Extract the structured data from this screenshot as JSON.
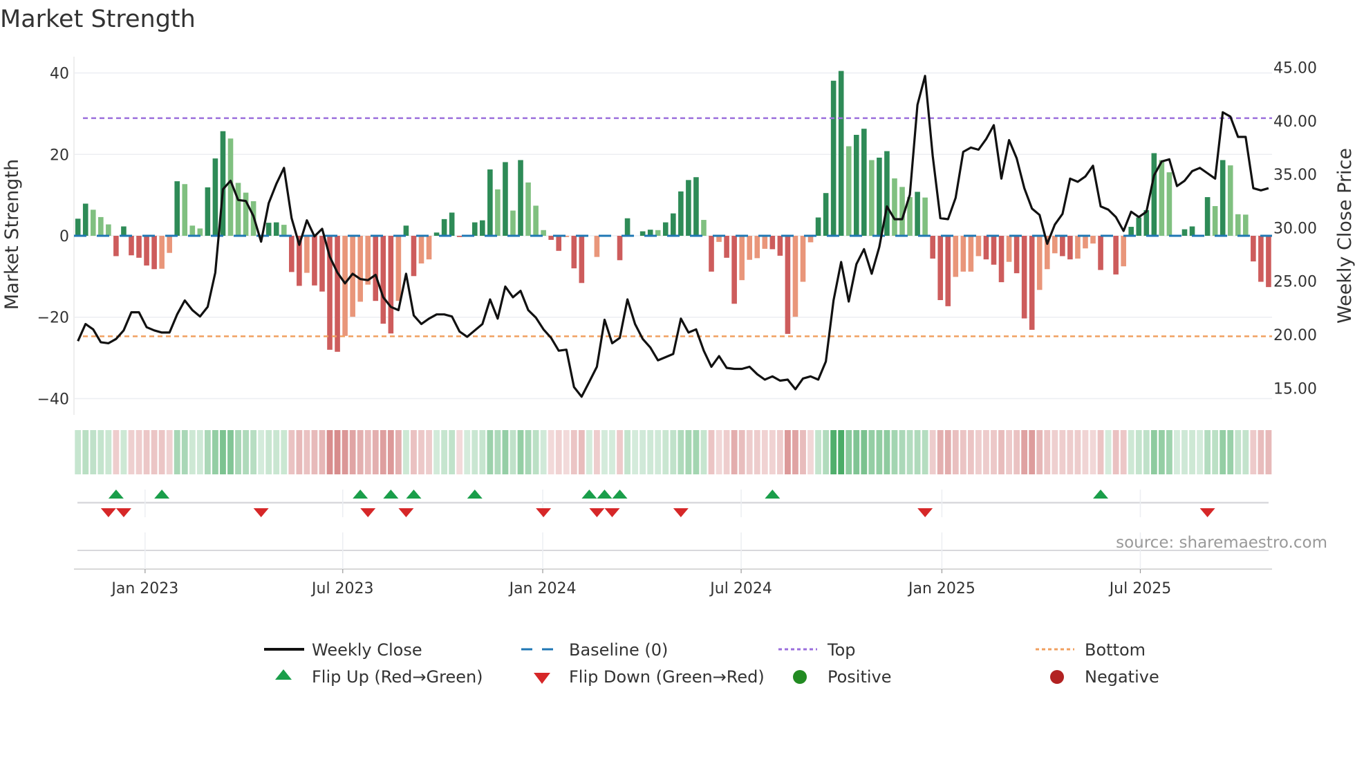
{
  "chart_data": {
    "type": "bar+line",
    "title": "Market Strength",
    "ylabel_left": "Market Strength",
    "ylabel_right": "Weekly Close Price",
    "ylim_left": [
      -44,
      44
    ],
    "ylim_right": [
      12.5,
      46.0
    ],
    "yticks_left": [
      {
        "value": 40,
        "label": "40"
      },
      {
        "value": 20,
        "label": "20"
      },
      {
        "value": 0,
        "label": "0"
      },
      {
        "value": -20,
        "label": "−20"
      },
      {
        "value": -40,
        "label": "−40"
      }
    ],
    "yticks_right": [
      {
        "value": 45,
        "label": "45.00"
      },
      {
        "value": 40,
        "label": "40.00"
      },
      {
        "value": 35,
        "label": "35.00"
      },
      {
        "value": 30,
        "label": "30.00"
      },
      {
        "value": 25,
        "label": "25.00"
      },
      {
        "value": 20,
        "label": "20.00"
      },
      {
        "value": 15,
        "label": "15.00"
      }
    ],
    "x_unit": "week index (weekly bars, first bar ~ early Nov 2022)",
    "xticks": [
      {
        "week": 9.8,
        "label": "Jan 2023"
      },
      {
        "week": 35.7,
        "label": "Jul 2023"
      },
      {
        "week": 61.9,
        "label": "Jan 2024"
      },
      {
        "week": 87.9,
        "label": "Jul 2024"
      },
      {
        "week": 114.2,
        "label": "Jan 2025"
      },
      {
        "week": 140.2,
        "label": "Jul 2025"
      }
    ],
    "strength": [
      4.2,
      7.9,
      6.4,
      4.6,
      2.8,
      -5.0,
      2.3,
      -4.8,
      -5.4,
      -7.3,
      -8.2,
      -8.1,
      -4.2,
      13.4,
      12.7,
      2.5,
      1.8,
      11.9,
      19.0,
      25.7,
      23.9,
      13.0,
      10.6,
      8.5,
      0,
      3.2,
      3.3,
      2.7,
      -8.9,
      -12.3,
      -9.1,
      -12.2,
      -13.7,
      -28.0,
      -28.5,
      -24.6,
      -19.9,
      -16.2,
      -12.0,
      -16.0,
      -21.6,
      -24.0,
      -16.0,
      2.5,
      -9.9,
      -6.8,
      -5.8,
      0.8,
      4.1,
      5.7,
      -0.3,
      0,
      3.3,
      3.8,
      16.3,
      11.4,
      18.1,
      6.2,
      18.6,
      13.1,
      7.4,
      1.4,
      -1.0,
      -3.7,
      -0.3,
      -8.0,
      -11.6,
      0,
      -5.2,
      0,
      0,
      -6.0,
      4.3,
      0,
      1.1,
      1.5,
      1.4,
      3.3,
      5.5,
      10.9,
      13.7,
      14.4,
      3.9,
      -8.8,
      -1.5,
      -5.4,
      -16.7,
      -10.9,
      -5.9,
      -5.5,
      -3.2,
      -3.3,
      -4.9,
      -24.1,
      -19.9,
      -11.3,
      -1.6,
      4.5,
      10.5,
      38.1,
      40.5,
      22.0,
      24.8,
      26.3,
      18.6,
      19.2,
      20.8,
      14.1,
      12.0,
      9.5,
      10.8,
      9.4,
      -5.6,
      -15.8,
      -17.3,
      -10.1,
      -8.8,
      -8.8,
      -5.0,
      -5.8,
      -7.1,
      -11.4,
      -6.4,
      -9.2,
      -20.3,
      -23.1,
      -13.3,
      -8.2,
      -4.3,
      -5.0,
      -5.8,
      -5.6,
      -3.1,
      -1.9,
      -8.4,
      0,
      -9.5,
      -7.5,
      2.2,
      4.5,
      6.3,
      20.3,
      18.6,
      15.6,
      0,
      1.6,
      2.3,
      0,
      9.5,
      7.3,
      18.6,
      17.3,
      5.3,
      5.2,
      -6.3,
      -11.3,
      -12.6
    ],
    "strengthening": [
      1,
      1,
      0,
      0,
      0,
      1,
      1,
      1,
      1,
      1,
      1,
      0,
      0,
      1,
      0,
      0,
      0,
      1,
      1,
      1,
      0,
      0,
      0,
      0,
      0,
      1,
      1,
      0,
      1,
      1,
      0,
      1,
      1,
      1,
      1,
      0,
      0,
      0,
      0,
      1,
      1,
      1,
      0,
      1,
      1,
      0,
      0,
      1,
      1,
      1,
      1,
      0,
      1,
      1,
      1,
      0,
      1,
      0,
      1,
      0,
      0,
      0,
      1,
      1,
      0,
      1,
      1,
      0,
      0,
      0,
      0,
      1,
      1,
      0,
      1,
      1,
      0,
      1,
      1,
      1,
      1,
      1,
      0,
      1,
      0,
      1,
      1,
      0,
      0,
      0,
      0,
      1,
      1,
      1,
      0,
      0,
      0,
      1,
      1,
      1,
      1,
      0,
      1,
      1,
      0,
      1,
      1,
      0,
      0,
      0,
      1,
      0,
      1,
      1,
      1,
      0,
      0,
      0,
      0,
      1,
      1,
      1,
      0,
      1,
      1,
      1,
      0,
      0,
      0,
      1,
      1,
      0,
      0,
      0,
      1,
      0,
      1,
      0,
      1,
      1,
      1,
      1,
      0,
      0,
      0,
      1,
      1,
      0,
      1,
      0,
      1,
      0,
      0,
      0,
      1,
      1,
      1
    ],
    "weekly_close": [
      19.4,
      21.0,
      20.5,
      19.3,
      19.2,
      19.6,
      20.4,
      22.1,
      22.1,
      20.7,
      20.4,
      20.2,
      20.2,
      21.9,
      23.2,
      22.3,
      21.7,
      22.6,
      25.8,
      33.6,
      34.4,
      32.6,
      32.5,
      31.1,
      28.7,
      32.3,
      34.1,
      35.6,
      30.9,
      28.4,
      30.7,
      29.2,
      29.9,
      27.3,
      25.8,
      24.8,
      25.7,
      25.2,
      25.1,
      25.6,
      23.5,
      22.6,
      22.3,
      25.7,
      21.8,
      21.0,
      21.5,
      21.9,
      21.9,
      21.7,
      20.3,
      19.8,
      20.4,
      21.0,
      23.3,
      21.5,
      24.5,
      23.5,
      24.1,
      22.3,
      21.6,
      20.5,
      19.7,
      18.5,
      18.6,
      15.1,
      14.2,
      15.6,
      17.0,
      21.4,
      19.2,
      19.7,
      23.3,
      21.0,
      19.6,
      18.8,
      17.6,
      17.9,
      18.2,
      21.5,
      20.2,
      20.5,
      18.5,
      17.0,
      18.0,
      16.9,
      16.8,
      16.8,
      17.0,
      16.3,
      15.8,
      16.1,
      15.7,
      15.8,
      14.9,
      15.9,
      16.1,
      15.8,
      17.5,
      23.2,
      26.8,
      23.1,
      26.6,
      28.0,
      25.7,
      28.2,
      32.0,
      30.8,
      30.8,
      33.1,
      41.5,
      44.2,
      36.7,
      30.9,
      30.8,
      32.8,
      37.1,
      37.5,
      37.3,
      38.3,
      39.6,
      34.6,
      38.2,
      36.5,
      33.7,
      31.8,
      31.2,
      28.5,
      30.3,
      31.3,
      34.6,
      34.3,
      34.8,
      35.8,
      32.0,
      31.7,
      31.0,
      29.7,
      31.5,
      31.0,
      31.5,
      34.9,
      36.2,
      36.4,
      33.9,
      34.4,
      35.3,
      35.6,
      35.1,
      34.6,
      40.8,
      40.4,
      38.5,
      38.5,
      33.7,
      33.5,
      33.7
    ],
    "baseline": 0,
    "top_level": 28.9,
    "bottom_level": -24.7,
    "flip_up_weeks": [
      6,
      12,
      38,
      42,
      45,
      53,
      68,
      70,
      72,
      92,
      135
    ],
    "flip_down_weeks": [
      5,
      7,
      25,
      39,
      44,
      62,
      69,
      71,
      80,
      112,
      149
    ],
    "colors": {
      "positive_strong": "#2e8b57",
      "positive_weak": "#80c080",
      "negative_strong": "#cd5c5c",
      "negative_weak": "#e9967a",
      "line": "#111111",
      "baseline": "#1f77b4",
      "top": "#9b6fdc",
      "bottom": "#f0a060",
      "flip_up": "#1a9e4a",
      "flip_down": "#d62728",
      "positive_dot": "#228b22",
      "negative_dot": "#b22222"
    },
    "legend": {
      "weekly_close": "Weekly Close",
      "baseline": "Baseline (0)",
      "top": "Top",
      "bottom": "Bottom",
      "flip_up": "Flip Up (Red→Green)",
      "flip_down": "Flip Down (Green→Red)",
      "positive": "Positive",
      "negative": "Negative"
    },
    "legend_placement": "bottom-center",
    "source": "source: sharemaestro.com"
  }
}
